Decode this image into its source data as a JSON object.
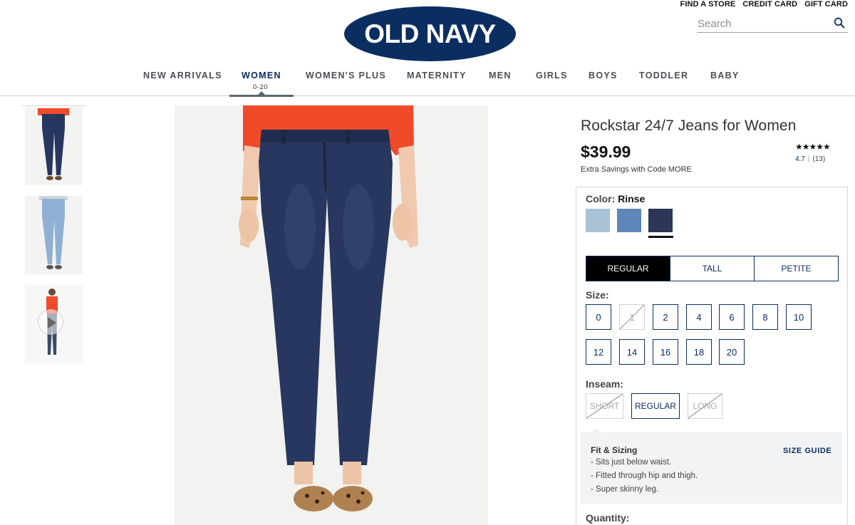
{
  "header": {
    "utility_links": [
      "FIND A STORE",
      "CREDIT CARD",
      "GIFT CARD"
    ],
    "search_placeholder": "Search",
    "logo_text": "OLD NAVY"
  },
  "nav": {
    "items": [
      "NEW ARRIVALS",
      "WOMEN",
      "WOMEN'S PLUS",
      "MATERNITY",
      "MEN",
      "GIRLS",
      "BOYS",
      "TODDLER",
      "BABY"
    ],
    "active_item": "WOMEN",
    "active_sub": "0-20"
  },
  "product": {
    "title": "Rockstar 24/7 Jeans for Women",
    "price": "$39.99",
    "promo": "Extra Savings with Code MORE",
    "rating": {
      "stars": "★★★★★",
      "value": "4.7",
      "count": "(13)"
    },
    "color": {
      "label": "Color:",
      "selected_name": "Rinse",
      "swatches": [
        {
          "name": "light wash",
          "hex": "#a9c2d8"
        },
        {
          "name": "medium wash",
          "hex": "#5e86b8"
        },
        {
          "name": "Rinse",
          "hex": "#2c3656",
          "selected": true
        }
      ]
    },
    "length_tabs": [
      {
        "label": "REGULAR",
        "selected": true
      },
      {
        "label": "TALL",
        "selected": false
      },
      {
        "label": "PETITE",
        "selected": false
      }
    ],
    "size": {
      "label": "Size:",
      "options": [
        {
          "label": "0",
          "available": true
        },
        {
          "label": "1",
          "available": false
        },
        {
          "label": "2",
          "available": true
        },
        {
          "label": "4",
          "available": true
        },
        {
          "label": "6",
          "available": true
        },
        {
          "label": "8",
          "available": true
        },
        {
          "label": "10",
          "available": true
        },
        {
          "label": "12",
          "available": true
        },
        {
          "label": "14",
          "available": true
        },
        {
          "label": "16",
          "available": true
        },
        {
          "label": "18",
          "available": true
        },
        {
          "label": "20",
          "available": true
        }
      ]
    },
    "inseam": {
      "label": "Inseam:",
      "options": [
        {
          "label": "SHORT",
          "available": false
        },
        {
          "label": "REGULAR",
          "available": true
        },
        {
          "label": "LONG",
          "available": false
        }
      ]
    },
    "fit": {
      "title": "Fit & Sizing",
      "size_guide": "SIZE GUIDE",
      "lines": [
        "- Sits just below waist.",
        "- Fitted through hip and thigh.",
        "- Super skinny leg."
      ]
    },
    "quantity_label": "Quantity:"
  },
  "colors": {
    "brand_navy": "#0b2e61",
    "shirt_orange": "#f04a2a",
    "denim_dark": "#27375f",
    "denim_light": "#8fb0d2"
  }
}
